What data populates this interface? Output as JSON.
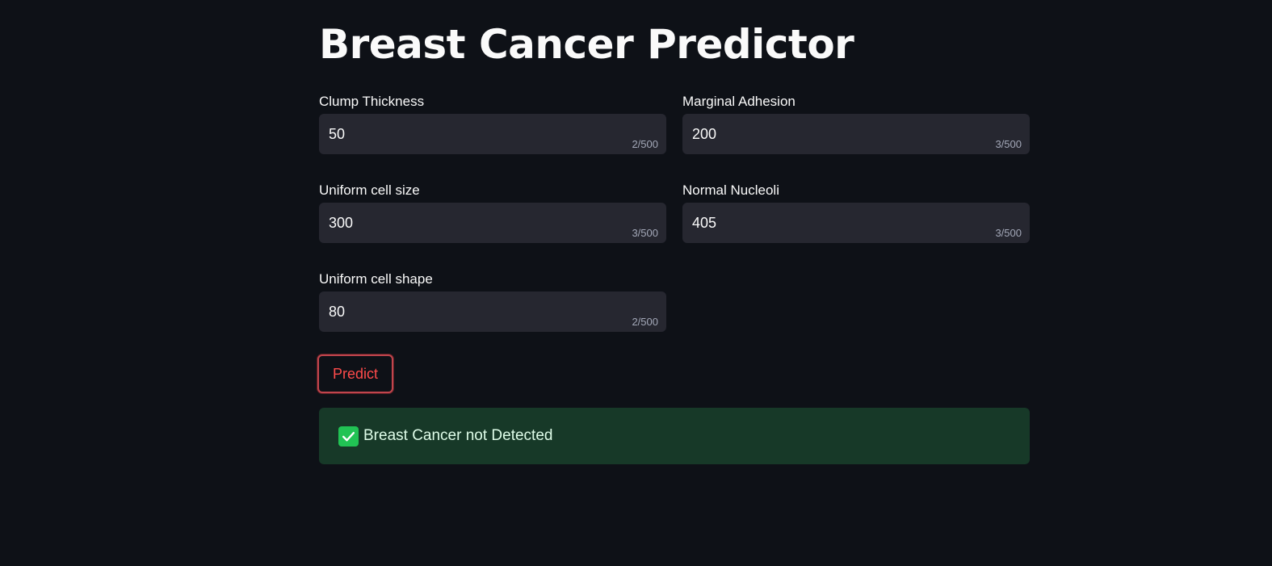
{
  "page": {
    "title": "Breast Cancer Predictor"
  },
  "fields": {
    "clump_thickness": {
      "label": "Clump Thickness",
      "value": "50",
      "counter": "2/500"
    },
    "marginal_adhesion": {
      "label": "Marginal Adhesion",
      "value": "200",
      "counter": "3/500"
    },
    "uniform_cell_size": {
      "label": "Uniform cell size",
      "value": "300",
      "counter": "3/500"
    },
    "normal_nucleoli": {
      "label": "Normal Nucleoli",
      "value": "405",
      "counter": "3/500"
    },
    "uniform_cell_shape": {
      "label": "Uniform cell shape",
      "value": "80",
      "counter": "2/500"
    }
  },
  "predict_button": {
    "label": "Predict",
    "color": "#ff4b4b"
  },
  "result": {
    "icon": "check-icon",
    "text": "Breast Cancer not Detected",
    "color": "#21c354"
  }
}
